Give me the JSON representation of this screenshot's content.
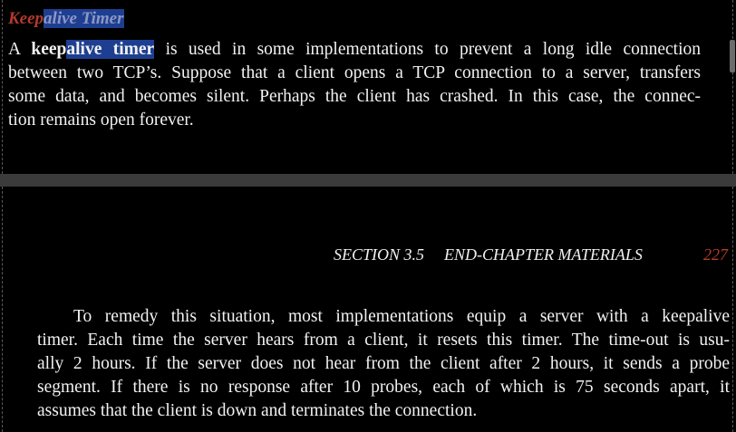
{
  "top_page": {
    "section_title": {
      "plain": "Keep",
      "highlighted": "alive Timer"
    },
    "paragraph": {
      "line1_pre": "A ",
      "line1_bold_plain": "keep",
      "line1_bold_highlighted": "alive timer",
      "line1_post": " is used in some implementations to prevent a long idle connection",
      "line2": "between two TCP’s. Suppose that a client opens a TCP connection to a server, transfers",
      "line3": "some data, and becomes silent. Perhaps the client has crashed. In this case, the connec-",
      "line4": "tion remains open forever."
    }
  },
  "bottom_page": {
    "running_head": {
      "section": "SECTION 3.5",
      "title": "END-CHAPTER MATERIALS",
      "page_number": "227"
    },
    "paragraph": {
      "lines": [
        "To remedy this situation, most implementations equip a server with a keepalive",
        "timer. Each time the server hears from a client, it resets this timer. The time-out is usu-",
        "ally 2 hours. If the server does not hear from the client after 2 hours, it sends a probe",
        "segment. If there is no response after 10 probes, each of which is 75 seconds apart, it",
        "assumes that the client is down and terminates the connection."
      ]
    }
  },
  "colors": {
    "background": "#000000",
    "text": "#f2f2f2",
    "accent": "#b33a2c",
    "highlight": "#1e3f91",
    "separator": "#3b3b3b"
  }
}
